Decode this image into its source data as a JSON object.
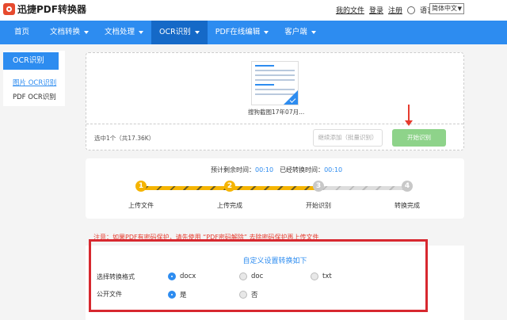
{
  "app": {
    "title": "迅捷PDF转换器"
  },
  "toplinks": {
    "my_files": "我的文件",
    "login": "登录",
    "register": "注册",
    "language_label": "语言",
    "language_value": "简体中文"
  },
  "nav": {
    "items": [
      {
        "label": "首页",
        "dropdown": false
      },
      {
        "label": "文档转换",
        "dropdown": true
      },
      {
        "label": "文档处理",
        "dropdown": true
      },
      {
        "label": "OCR识别",
        "dropdown": true,
        "active": true
      },
      {
        "label": "PDF在线编辑",
        "dropdown": true
      },
      {
        "label": "客户端",
        "dropdown": true
      }
    ]
  },
  "sidebar": {
    "header": "OCR识别",
    "items": [
      {
        "label": "图片 OCR识别",
        "active": true
      },
      {
        "label": "PDF OCR识别",
        "active": false
      }
    ]
  },
  "upload": {
    "file_name": "搜狗截图17年07月...",
    "selected_text": "选中1个（共17.36K）",
    "add_button": "继续添加（批量识别）",
    "start_button": "开始识别"
  },
  "progress": {
    "remaining_label": "预计剩余时间：",
    "remaining_value": "00:10",
    "elapsed_label": "已经转换时间：",
    "elapsed_value": "00:10",
    "steps": [
      {
        "num": "1",
        "label": "上传文件",
        "done": true
      },
      {
        "num": "2",
        "label": "上传完成",
        "done": true
      },
      {
        "num": "3",
        "label": "开始识别",
        "done": false
      },
      {
        "num": "4",
        "label": "转换完成",
        "done": false
      }
    ]
  },
  "warning": {
    "text_before": "注意：如果PDF有密码保护，请先使用",
    "link": "“PDF密码解除”",
    "text_after": "去除密码保护再上传文件"
  },
  "settings": {
    "title": "自定义设置转换如下",
    "format_label": "选择转换格式",
    "format_options": [
      {
        "label": "docx",
        "checked": true
      },
      {
        "label": "doc",
        "checked": false
      },
      {
        "label": "txt",
        "checked": false
      }
    ],
    "public_label": "公开文件",
    "public_options": [
      {
        "label": "是",
        "checked": true
      },
      {
        "label": "否",
        "checked": false
      }
    ]
  },
  "colors": {
    "primary": "#2d8cf0",
    "nav_active": "#1569c7",
    "progress_done": "#f5b400",
    "start_button": "#8ed38a",
    "highlight_box": "#d7282f"
  }
}
